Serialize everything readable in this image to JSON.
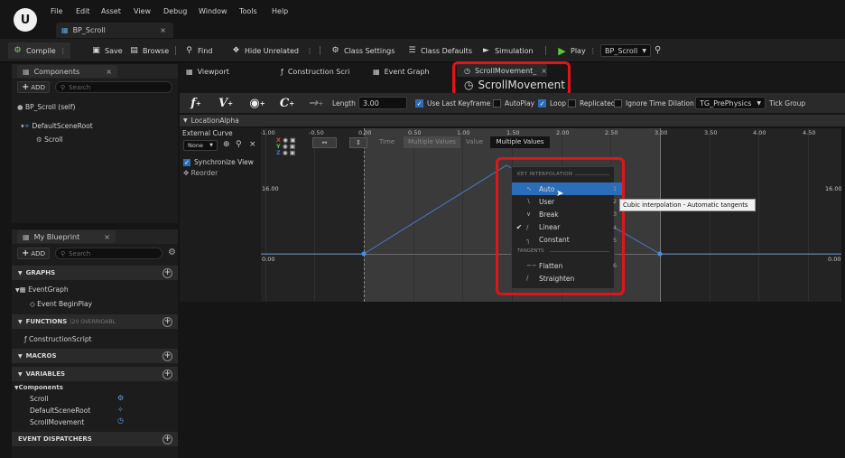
{
  "menubar": {
    "items": [
      "File",
      "Edit",
      "Asset",
      "View",
      "Debug",
      "Window",
      "Tools",
      "Help"
    ],
    "doc_tab": "BP_Scroll"
  },
  "toolbar": {
    "compile": "Compile",
    "save": "Save",
    "browse": "Browse",
    "find": "Find",
    "hide_unrelated": "Hide Unrelated",
    "class_settings": "Class Settings",
    "class_defaults": "Class Defaults",
    "simulation": "Simulation",
    "play": "Play",
    "debug_target": "BP_Scroll"
  },
  "components": {
    "title": "Components",
    "add": "ADD",
    "search_placeholder": "Search",
    "items": [
      "BP_Scroll (self)",
      "DefaultSceneRoot",
      "Scroll"
    ]
  },
  "my_blueprint": {
    "title": "My Blueprint",
    "add": "ADD",
    "search_placeholder": "Search",
    "graphs": "GRAPHS",
    "event_graph": "EventGraph",
    "begin_play": "Event BeginPlay",
    "functions": "FUNCTIONS",
    "functions_sub": "(20 OVERRIDABL",
    "construction_script": "ConstructionScript",
    "macros": "MACROS",
    "variables": "VARIABLES",
    "components_cat": "Components",
    "vars": [
      "Scroll",
      "DefaultSceneRoot",
      "ScrollMovement"
    ],
    "event_dispatchers": "EVENT DISPATCHERS"
  },
  "editor_tabs": [
    "Viewport",
    "Construction Scri",
    "Event Graph",
    "ScrollMovement_"
  ],
  "timeline_name": "ScrollMovement",
  "timeline_toolbar": {
    "length_label": "Length",
    "length_value": "3.00",
    "use_last_keyframe": "Use Last Keyframe",
    "autoplay": "AutoPlay",
    "loop": "Loop",
    "replicated": "Replicated",
    "ignore_time_dilation": "Ignore Time Dilation",
    "tick_group_value": "TG_PrePhysics",
    "tick_group_label": "Tick Group"
  },
  "track": {
    "name": "LocationAlpha",
    "external_curve": "External Curve",
    "none": "None",
    "synchronize_view": "Synchronize View",
    "reorder": "Reorder",
    "xyz": [
      "X",
      "Y",
      "Z"
    ]
  },
  "graph": {
    "time_label": "Time",
    "time_value": "Multiple Values",
    "value_label": "Value",
    "value_value": "Multiple Values",
    "ticks": [
      "-1.00",
      "-0.50",
      "0.00",
      "0.50",
      "1.00",
      "1.50",
      "2.00",
      "2.50",
      "3.00",
      "3.50",
      "4.00",
      "4.50"
    ],
    "y_top": "16.00",
    "y_zero": "0.00"
  },
  "dropdown": {
    "header": "KEY INTERPOLATION",
    "items": [
      {
        "label": "Auto",
        "key": "1",
        "icon": "auto",
        "checked": false
      },
      {
        "label": "User",
        "key": "2",
        "icon": "user",
        "checked": false
      },
      {
        "label": "Break",
        "key": "3",
        "icon": "break",
        "checked": false
      },
      {
        "label": "Linear",
        "key": "4",
        "icon": "linear",
        "checked": true
      },
      {
        "label": "Constant",
        "key": "5",
        "icon": "constant",
        "checked": false
      }
    ],
    "tangents_header": "TANGENTS",
    "tangents": [
      {
        "label": "Flatten",
        "key": "6"
      },
      {
        "label": "Straighten",
        "key": ""
      }
    ]
  },
  "tooltip": "Cubic interpolation - Automatic tangents",
  "colors": {
    "accent": "#2b6db8",
    "highlight": "#e1141a",
    "play": "#5ec63a",
    "curve": "#4a78c4"
  }
}
